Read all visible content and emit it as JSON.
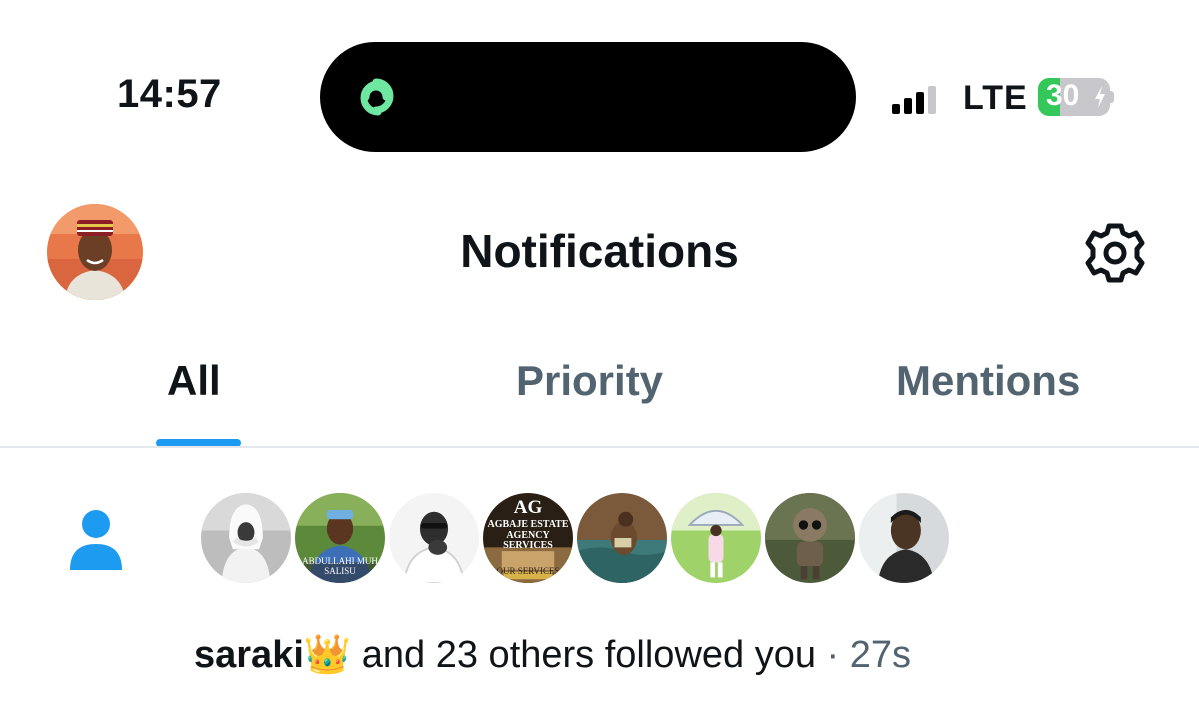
{
  "status_bar": {
    "time": "14:57",
    "network": "LTE",
    "battery_percent": "30",
    "battery_level": 0.3,
    "signal_bars_filled": 3,
    "signal_bars_total": 4,
    "island_icon": "linked-rings-icon",
    "island_icon_color": "#6ee7a0"
  },
  "header": {
    "title": "Notifications",
    "avatar_icon": "user-avatar",
    "settings_icon": "gear-icon"
  },
  "tabs": [
    {
      "label": "All",
      "active": true
    },
    {
      "label": "Priority",
      "active": false
    },
    {
      "label": "Mentions",
      "active": false
    }
  ],
  "notification": {
    "type_icon": "person-icon",
    "follower_count_avatars": 8,
    "name": "saraki",
    "emoji": "👑",
    "message": " and 23 others followed you",
    "separator": " · ",
    "time": "27s",
    "avatar_captions": {
      "agbaje_title": "AG",
      "agbaje_subtitle": "AGBAJE ESTATE AGENCY SERVICES",
      "agbaje_footer": "OUR SERVICES",
      "abdullahi": "ABDULLAHI MUH SALISU"
    }
  },
  "colors": {
    "accent": "#1d9bf0",
    "text_primary": "#0f1419",
    "text_secondary": "#536471",
    "battery_green": "#34c759",
    "divider": "#e4e8eb"
  }
}
